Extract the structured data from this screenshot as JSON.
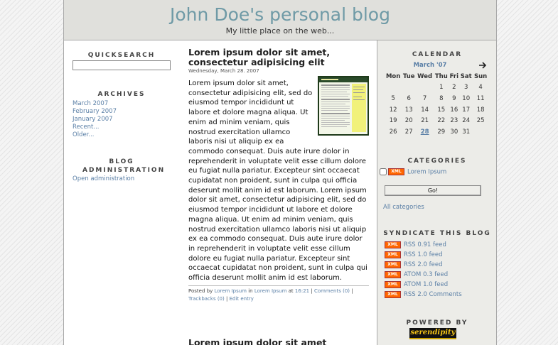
{
  "header": {
    "title": "John Doe's personal blog",
    "description": "My little place on the web..."
  },
  "left": {
    "quicksearch_title": "QUICKSEARCH",
    "quicksearch_value": "",
    "archives_title": "ARCHIVES",
    "archives": [
      "March 2007",
      "February 2007",
      "January 2007",
      "Recent...",
      "Older..."
    ],
    "admin_title": "BLOG ADMINISTRATION",
    "admin_link": "Open administration"
  },
  "entry": {
    "title": "Lorem ipsum dolor sit amet, consectetur adipisicing elit",
    "date": "Wednesday, March 28. 2007",
    "body": "Lorem ipsum dolor sit amet, consectetur adipisicing elit, sed do eiusmod tempor incididunt ut labore et dolore magna aliqua. Ut enim ad minim veniam, quis nostrud exercitation ullamco laboris nisi ut aliquip ex ea commodo consequat. Duis aute irure dolor in reprehenderit in voluptate velit esse cillum dolore eu fugiat nulla pariatur. Excepteur sint occaecat cupidatat non proident, sunt in culpa qui officia deserunt mollit anim id est laborum. Lorem ipsum dolor sit amet, consectetur adipisicing elit, sed do eiusmod tempor incididunt ut labore et dolore magna aliqua. Ut enim ad minim veniam, quis nostrud exercitation ullamco laboris nisi ut aliquip ex ea commodo consequat. Duis aute irure dolor in reprehenderit in voluptate velit esse cillum dolore eu fugiat nulla pariatur. Excepteur sint occaecat cupidatat non proident, sunt in culpa qui officia deserunt mollit anim id est laborum.",
    "footer": {
      "posted_by": "Posted by",
      "author": "Lorem Ipsum",
      "in": "in",
      "category": "Lorem Ipsum",
      "at": "at",
      "time": "16:21",
      "sep": "|",
      "comments": "Comments (0)",
      "trackbacks": "Trackbacks (0)",
      "edit": "Edit entry"
    }
  },
  "entry2": {
    "title": "Lorem ipsum dolor sit amet"
  },
  "right": {
    "calendar_title": "CALENDAR",
    "calendar_month": "March '07",
    "calendar_days": [
      "Mon",
      "Tue",
      "Wed",
      "Thu",
      "Fri",
      "Sat",
      "Sun"
    ],
    "calendar_weeks": [
      [
        "",
        "",
        "",
        "1",
        "2",
        "3",
        "4"
      ],
      [
        "5",
        "6",
        "7",
        "8",
        "9",
        "10",
        "11"
      ],
      [
        "12",
        "13",
        "14",
        "15",
        "16",
        "17",
        "18"
      ],
      [
        "19",
        "20",
        "21",
        "22",
        "23",
        "24",
        "25"
      ],
      [
        "26",
        "27",
        "28",
        "29",
        "30",
        "31",
        ""
      ]
    ],
    "calendar_highlight": "28",
    "categories_title": "CATEGORIES",
    "category_item": "Lorem Ipsum",
    "go_button": "Go!",
    "all_categories": "All categories",
    "syndicate_title": "SYNDICATE THIS BLOG",
    "xml_badge": "XML",
    "feeds": [
      "RSS 0.91 feed",
      "RSS 1.0 feed",
      "RSS 2.0 feed",
      "ATOM 0.3 feed",
      "ATOM 1.0 feed",
      "RSS 2.0 Comments"
    ],
    "powered_title": "POWERED BY",
    "powered_logo": "serendipity"
  },
  "colors": {
    "title": "#6f9aa6",
    "link": "#5a7fa6",
    "header_bg": "#e0e0dc",
    "sidebar_bg": "#ecece8",
    "xml_badge": "#ff6600"
  }
}
